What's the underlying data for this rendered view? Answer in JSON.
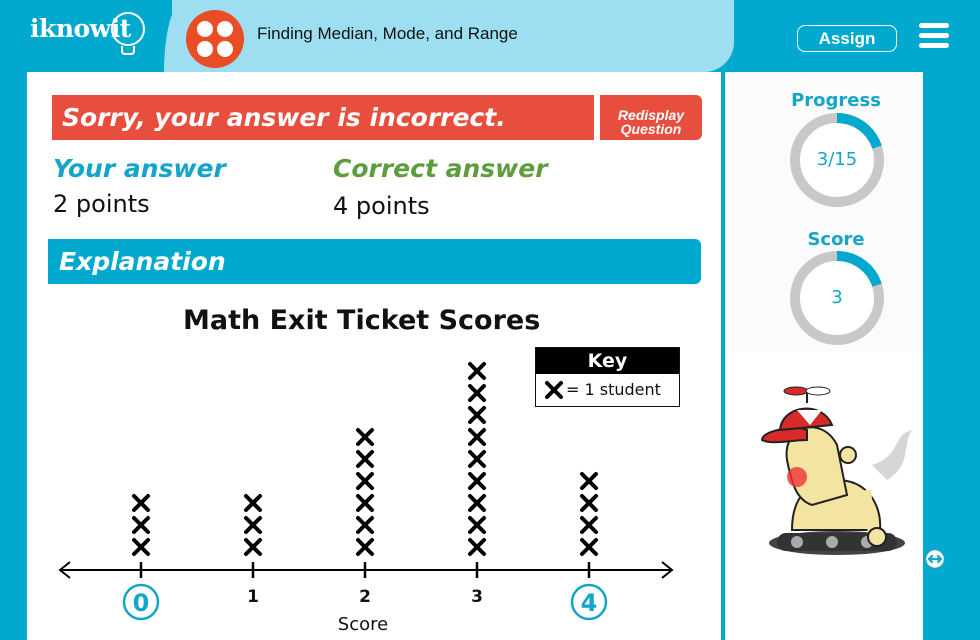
{
  "header": {
    "logo": "iknowit",
    "lesson_icon": "four-dots-icon",
    "lesson_title": "Finding Median, Mode, and Range",
    "assign_label": "Assign",
    "menu_icon": "hamburger-menu-icon"
  },
  "feedback": {
    "banner": "Sorry, your answer is incorrect.",
    "redisplay_line1": "Redisplay",
    "redisplay_line2": "Question",
    "your_answer_label": "Your answer",
    "your_answer_value": "2 points",
    "correct_answer_label": "Correct answer",
    "correct_answer_value": "4 points"
  },
  "explanation": {
    "heading": "Explanation"
  },
  "chart_data": {
    "type": "scatter",
    "subtype": "line-plot",
    "title": "Math Exit Ticket Scores",
    "xlabel": "Score",
    "categories": [
      "0",
      "1",
      "2",
      "3",
      "4"
    ],
    "values": [
      3,
      3,
      6,
      9,
      4
    ],
    "highlighted_categories": [
      "0",
      "4"
    ],
    "key_title": "Key",
    "key_text": "= 1 student",
    "marker": "X",
    "highlight_color": "#14a5c9"
  },
  "sidebar": {
    "progress_label": "Progress",
    "progress_text": "3/15",
    "progress_fraction": 0.2,
    "score_label": "Score",
    "score_text": "3",
    "score_fraction": 0.2,
    "expand_icon": "expand-horizontal-icon"
  },
  "colors": {
    "brand": "#01a9ce",
    "error": "#e84e3d",
    "correct": "#5e9d3e",
    "ring_track": "#c8c8c8"
  }
}
